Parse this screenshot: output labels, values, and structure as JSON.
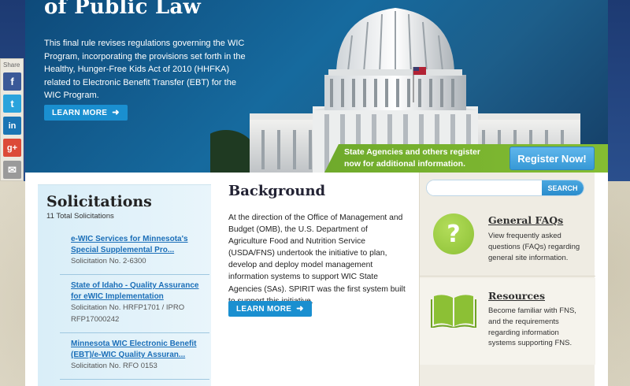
{
  "hero": {
    "title": "of Public Law",
    "description": "This final rule revises regulations governing the WIC Program, incorporating the provisions set forth in the Healthy, Hunger-Free Kids Act of 2010 (HHFKA) related to Electronic Benefit Transfer (EBT) for the WIC Program.",
    "learn_more": "LEARN MORE"
  },
  "register": {
    "text": "State Agencies and others register now for additional information.",
    "button": "Register Now!"
  },
  "share": {
    "label": "Share",
    "buttons": [
      {
        "icon": "facebook-icon",
        "glyph": "f",
        "color": "#3b5998"
      },
      {
        "icon": "twitter-icon",
        "glyph": "t",
        "color": "#2aa3dc"
      },
      {
        "icon": "linkedin-icon",
        "glyph": "in",
        "color": "#1b75b4"
      },
      {
        "icon": "google-plus-icon",
        "glyph": "g+",
        "color": "#dc4a38"
      },
      {
        "icon": "email-icon",
        "glyph": "✉",
        "color": "#9a9a9a"
      }
    ]
  },
  "solicitations": {
    "title": "Solicitations",
    "count": "11 Total Solicitations",
    "items": [
      {
        "title": "e-WIC Services for Minnesota's Special Supplemental Pro...",
        "number": "Solicitation No. 2-6300"
      },
      {
        "title": "State of Idaho - Quality Assurance for eWIC Implementation",
        "number": "Solicitation No. HRFP1701 / IPRO RFP17000242"
      },
      {
        "title": "Minnesota WIC Electronic Benefit (EBT)/e-WIC Quality Assuran...",
        "number": "Solicitation No. RFO 0153"
      }
    ]
  },
  "background": {
    "title": "Background",
    "text": "At the direction of the Office of Management and Budget (OMB), the U.S. Department of Agriculture Food and Nutrition Service (USDA/FNS) undertook the initiative to plan, develop and deploy model management information systems to support WIC State Agencies (SAs). SPIRIT was the first system built to support this initiative.",
    "learn_more": "LEARN MORE"
  },
  "search": {
    "placeholder": "",
    "button": "SEARCH"
  },
  "general_faqs": {
    "title": "General FAQs",
    "description": "View frequently asked questions (FAQs) regarding general site information."
  },
  "resources": {
    "title": "Resources",
    "description": "Become familiar with FNS, and the requirements regarding information systems supporting FNS."
  },
  "colors": {
    "navy": "#1d3a72",
    "accent_blue": "#1a8fd0",
    "link": "#1a6eb8",
    "green": "#84bd32"
  }
}
